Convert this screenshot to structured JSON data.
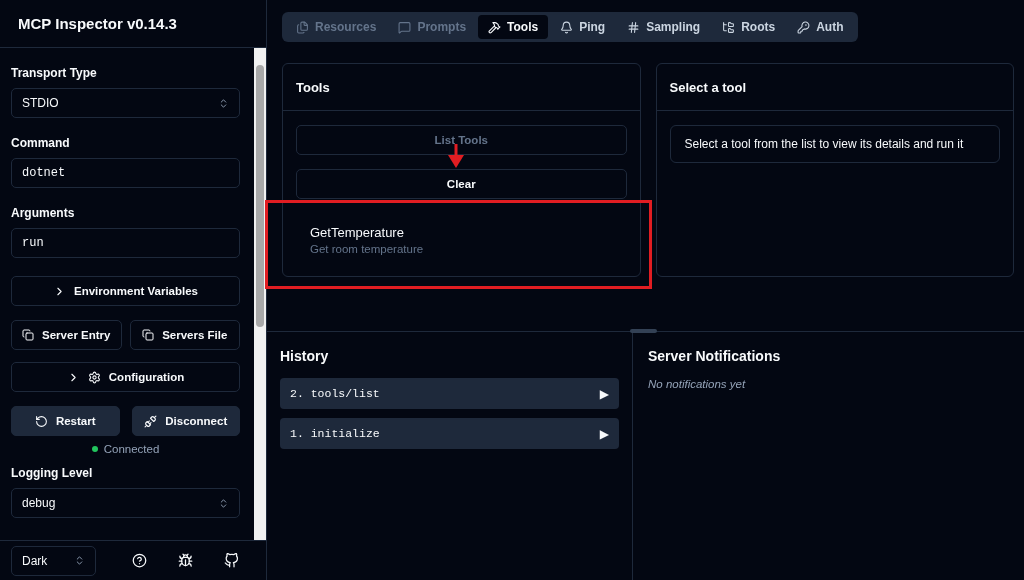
{
  "app": {
    "title": "MCP Inspector v0.14.3"
  },
  "sidebar": {
    "fields": [
      {
        "kind": "select",
        "label": "Transport Type",
        "value": "STDIO"
      },
      {
        "kind": "input",
        "label": "Command",
        "value": "dotnet"
      },
      {
        "kind": "input",
        "label": "Arguments",
        "value": "run"
      }
    ],
    "env_button": {
      "label": "Environment Variables",
      "expanded": false
    },
    "copy_buttons": [
      "Server Entry",
      "Servers File"
    ],
    "config_button": {
      "label": "Configuration",
      "expanded": false
    },
    "action_buttons": [
      {
        "kind": "restart",
        "label": "Restart"
      },
      {
        "kind": "disconnect",
        "label": "Disconnect"
      }
    ],
    "status": {
      "text": "Connected",
      "connected": true
    },
    "logging": {
      "label": "Logging Level",
      "value": "debug"
    },
    "theme": {
      "value": "Dark"
    }
  },
  "tabs": [
    {
      "kind": "resources",
      "label": "Resources",
      "selected": false,
      "disabled": true
    },
    {
      "kind": "prompts",
      "label": "Prompts",
      "selected": false,
      "disabled": true
    },
    {
      "kind": "tools",
      "label": "Tools",
      "selected": true,
      "disabled": false
    },
    {
      "kind": "ping",
      "label": "Ping",
      "selected": false,
      "disabled": false
    },
    {
      "kind": "sampling",
      "label": "Sampling",
      "selected": false,
      "disabled": false
    },
    {
      "kind": "roots",
      "label": "Roots",
      "selected": false,
      "disabled": false
    },
    {
      "kind": "auth",
      "label": "Auth",
      "selected": false,
      "disabled": false
    }
  ],
  "tools_panel": {
    "title": "Tools",
    "list_button": {
      "label": "List Tools",
      "disabled": true
    },
    "clear_button": "Clear",
    "tools": [
      {
        "name": "GetTemperature",
        "description": "Get room temperature"
      }
    ]
  },
  "detail_panel": {
    "title": "Select a tool",
    "message": "Select a tool from the list to view its details and run it"
  },
  "history": {
    "title": "History",
    "items": [
      {
        "label": "2. tools/list",
        "toggle": "▶"
      },
      {
        "label": "1. initialize",
        "toggle": "▶"
      }
    ]
  },
  "notifications": {
    "title": "Server Notifications",
    "empty": "No notifications yet"
  }
}
